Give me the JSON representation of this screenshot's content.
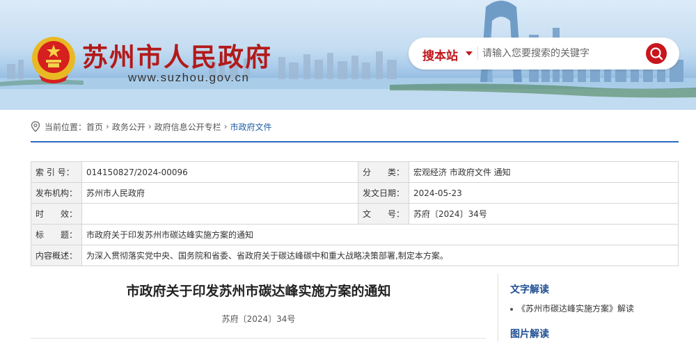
{
  "header": {
    "site_title": "苏州市人民政府",
    "site_url": "www.suzhou.gov.cn",
    "search": {
      "site_label": "搜本站",
      "placeholder": "请输入您要搜索的关键字"
    }
  },
  "breadcrumb": {
    "prefix": "当前位置：",
    "items": [
      "首页",
      "政务公开",
      "政府信息公开专栏",
      "市政府文件"
    ],
    "separator": "›"
  },
  "info": {
    "rows": [
      {
        "label1": "索 引 号：",
        "value1": "014150827/2024-00096",
        "label2": "分　　类：",
        "value2": "宏观经济 市政府文件 通知"
      },
      {
        "label1": "发布机构：",
        "value1": "苏州市人民政府",
        "label2": "发文日期：",
        "value2": "2024-05-23"
      },
      {
        "label1": "时　　效：",
        "value1": "",
        "label2": "文　　号：",
        "value2": "苏府〔2024〕34号"
      }
    ],
    "title_label": "标　　题：",
    "title_value": "市政府关于印发苏州市碳达峰实施方案的通知",
    "summary_label": "内容概述：",
    "summary_value": "为深入贯彻落实党中央、国务院和省委、省政府关于碳达峰碳中和重大战略决策部署,制定本方案。"
  },
  "article": {
    "title": "市政府关于印发苏州市碳达峰实施方案的通知",
    "doc_number": "苏府〔2024〕34号"
  },
  "sidebar": {
    "text_section": "文字解读",
    "text_link": "《苏州市碳达峰实施方案》解读",
    "image_section": "图片解读"
  },
  "colors": {
    "brand_red": "#b21a1a",
    "accent_blue": "#2a6cc1",
    "sidebar_heading": "#1f4f93"
  }
}
